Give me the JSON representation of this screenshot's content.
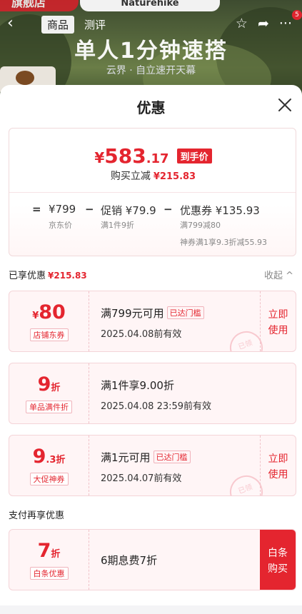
{
  "background": {
    "store_ribbon": "旗舰店",
    "brand": "Naturehike",
    "nav_tabs": [
      "商品",
      "测评"
    ],
    "badge_count": "5",
    "hero_title": "单人1分钟速搭",
    "hero_subtitle": "云界 · 自立速开天幕"
  },
  "sheet": {
    "title": "优惠",
    "price": {
      "symbol": "¥",
      "integer": "583",
      "decimal": ".17",
      "final_tag": "到手价",
      "reduce_label": "购买立减",
      "reduce_amount": "¥215.83"
    },
    "breakdown": {
      "op_equal": "=",
      "op_minus": "−",
      "jd_price": "¥799",
      "jd_label": "京东价",
      "promo_price": "促销 ¥79.9",
      "promo_sub": "满1件9折",
      "coupon_price": "优惠券 ¥135.93",
      "coupon_sub1": "满799减80",
      "coupon_sub2": "神券满1享9.3折减55.93"
    },
    "enjoyed": {
      "label": "已享优惠",
      "amount": "¥215.83",
      "collapse": "收起 ^"
    },
    "coupons": [
      {
        "currency": "¥",
        "value": "80",
        "unit": "",
        "tag": "店铺东券",
        "condition": "满799元可用",
        "reached": "已达门槛",
        "expiry": "2025.04.08前有效",
        "action": "立即使用",
        "stamp": "已领"
      },
      {
        "currency": "",
        "value": "9",
        "unit": "折",
        "tag": "单品满件折",
        "condition": "满1件享9.00折",
        "reached": "",
        "expiry": "2025.04.08 23:59前有效",
        "action": "",
        "stamp": ""
      },
      {
        "currency": "",
        "value": "9",
        "unit": ".3折",
        "tag": "大促神券",
        "condition": "满1元可用",
        "reached": "已达门槛",
        "expiry": "2025.04.07前有效",
        "action": "立即使用",
        "stamp": "已领"
      }
    ],
    "pay_section": {
      "label": "支付再享优惠",
      "coupon": {
        "value": "7",
        "unit": "折",
        "tag": "白条优惠",
        "condition": "6期息费7折",
        "action": "白条购买"
      }
    }
  },
  "colors": {
    "accent": "#e4252f",
    "coupon_bg": "#fff5f6"
  }
}
